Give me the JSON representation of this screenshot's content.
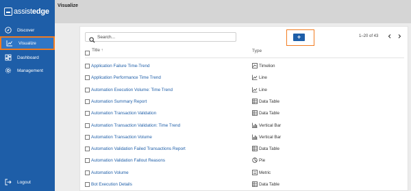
{
  "app": {
    "logo_prefix": "assist",
    "logo_bold": "edge"
  },
  "sidebar": {
    "items": [
      {
        "label": "Discover",
        "icon": "compass-icon"
      },
      {
        "label": "Visualize",
        "icon": "chart-icon",
        "active": true
      },
      {
        "label": "Dashboard",
        "icon": "dashboard-icon"
      },
      {
        "label": "Management",
        "icon": "gear-icon"
      }
    ],
    "logout_label": "Logout"
  },
  "header": {
    "title": "Visualize"
  },
  "search": {
    "placeholder": "Search..."
  },
  "toolbar": {
    "add_label": "+"
  },
  "pager": {
    "text": "1–20 of 43"
  },
  "table": {
    "columns": [
      "Title",
      "Type"
    ],
    "rows": [
      {
        "title": "Application Failure Time-Trend",
        "type": "Timelion",
        "icon": "timelion-icon"
      },
      {
        "title": "Application Performance Time Trend",
        "type": "Line",
        "icon": "line-chart-icon"
      },
      {
        "title": "Automation Execution Volume: Time Trend",
        "type": "Line",
        "icon": "line-chart-icon"
      },
      {
        "title": "Automation Summary Report",
        "type": "Data Table",
        "icon": "table-icon"
      },
      {
        "title": "Automation Transaction Validation",
        "type": "Data Table",
        "icon": "table-icon"
      },
      {
        "title": "Automation Transaction Validation: Time Trend",
        "type": "Vertical Bar",
        "icon": "bar-chart-icon"
      },
      {
        "title": "Automation Transaction Volume",
        "type": "Vertical Bar",
        "icon": "bar-chart-icon"
      },
      {
        "title": "Automation Validation Failed Transactions Report",
        "type": "Data Table",
        "icon": "table-icon"
      },
      {
        "title": "Automation Validation Fallout Reasons",
        "type": "Pie",
        "icon": "pie-chart-icon"
      },
      {
        "title": "Automation Volume",
        "type": "Metric",
        "icon": "metric-icon"
      },
      {
        "title": "Bot Execution Details",
        "type": "Data Table",
        "icon": "table-icon"
      }
    ]
  },
  "colors": {
    "sidebar": "#1e5ea8",
    "sidebar_active": "#2f76c6",
    "highlight": "#f27b1f",
    "link": "#1e5ea8"
  }
}
